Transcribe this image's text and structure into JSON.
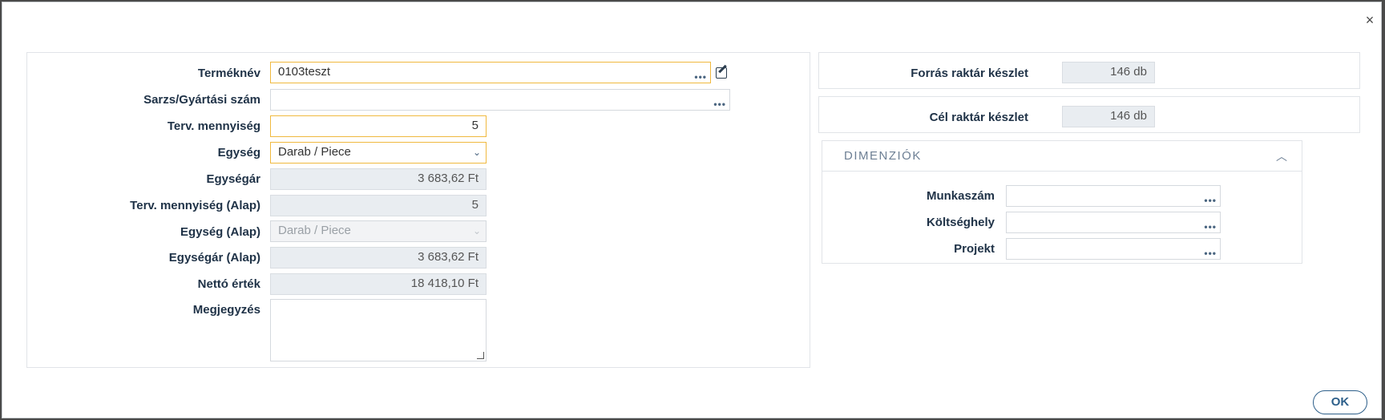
{
  "dialog": {
    "close_glyph": "×",
    "ok_label": "OK"
  },
  "left": {
    "product_name": {
      "label": "Terméknév",
      "value": "0103teszt"
    },
    "batch": {
      "label": "Sarzs/Gyártási szám",
      "value": ""
    },
    "planned_qty": {
      "label": "Terv. mennyiség",
      "value": "5"
    },
    "unit": {
      "label": "Egység",
      "value": "Darab / Piece"
    },
    "unit_price": {
      "label": "Egységár",
      "value": "3 683,62 Ft"
    },
    "planned_qty_base": {
      "label": "Terv. mennyiség (Alap)",
      "value": "5"
    },
    "unit_base": {
      "label": "Egység (Alap)",
      "value": "Darab / Piece"
    },
    "unit_price_base": {
      "label": "Egységár (Alap)",
      "value": "3 683,62 Ft"
    },
    "net_value": {
      "label": "Nettó érték",
      "value": "18 418,10 Ft"
    },
    "note": {
      "label": "Megjegyzés",
      "value": ""
    }
  },
  "right": {
    "source_stock": {
      "label": "Forrás raktár készlet",
      "value": "146 db"
    },
    "target_stock": {
      "label": "Cél raktár készlet",
      "value": "146 db"
    },
    "dimensions": {
      "title": "DIMENZIÓK",
      "work_number": {
        "label": "Munkaszám",
        "value": ""
      },
      "cost_center": {
        "label": "Költséghely",
        "value": ""
      },
      "project": {
        "label": "Projekt",
        "value": ""
      }
    }
  },
  "icons": {
    "dots": "•••",
    "chevron": "⌄",
    "caret_up": "︿"
  },
  "colors": {
    "focus_border": "#f0b93f",
    "accent": "#2d5f8a",
    "label": "#1f3247"
  }
}
